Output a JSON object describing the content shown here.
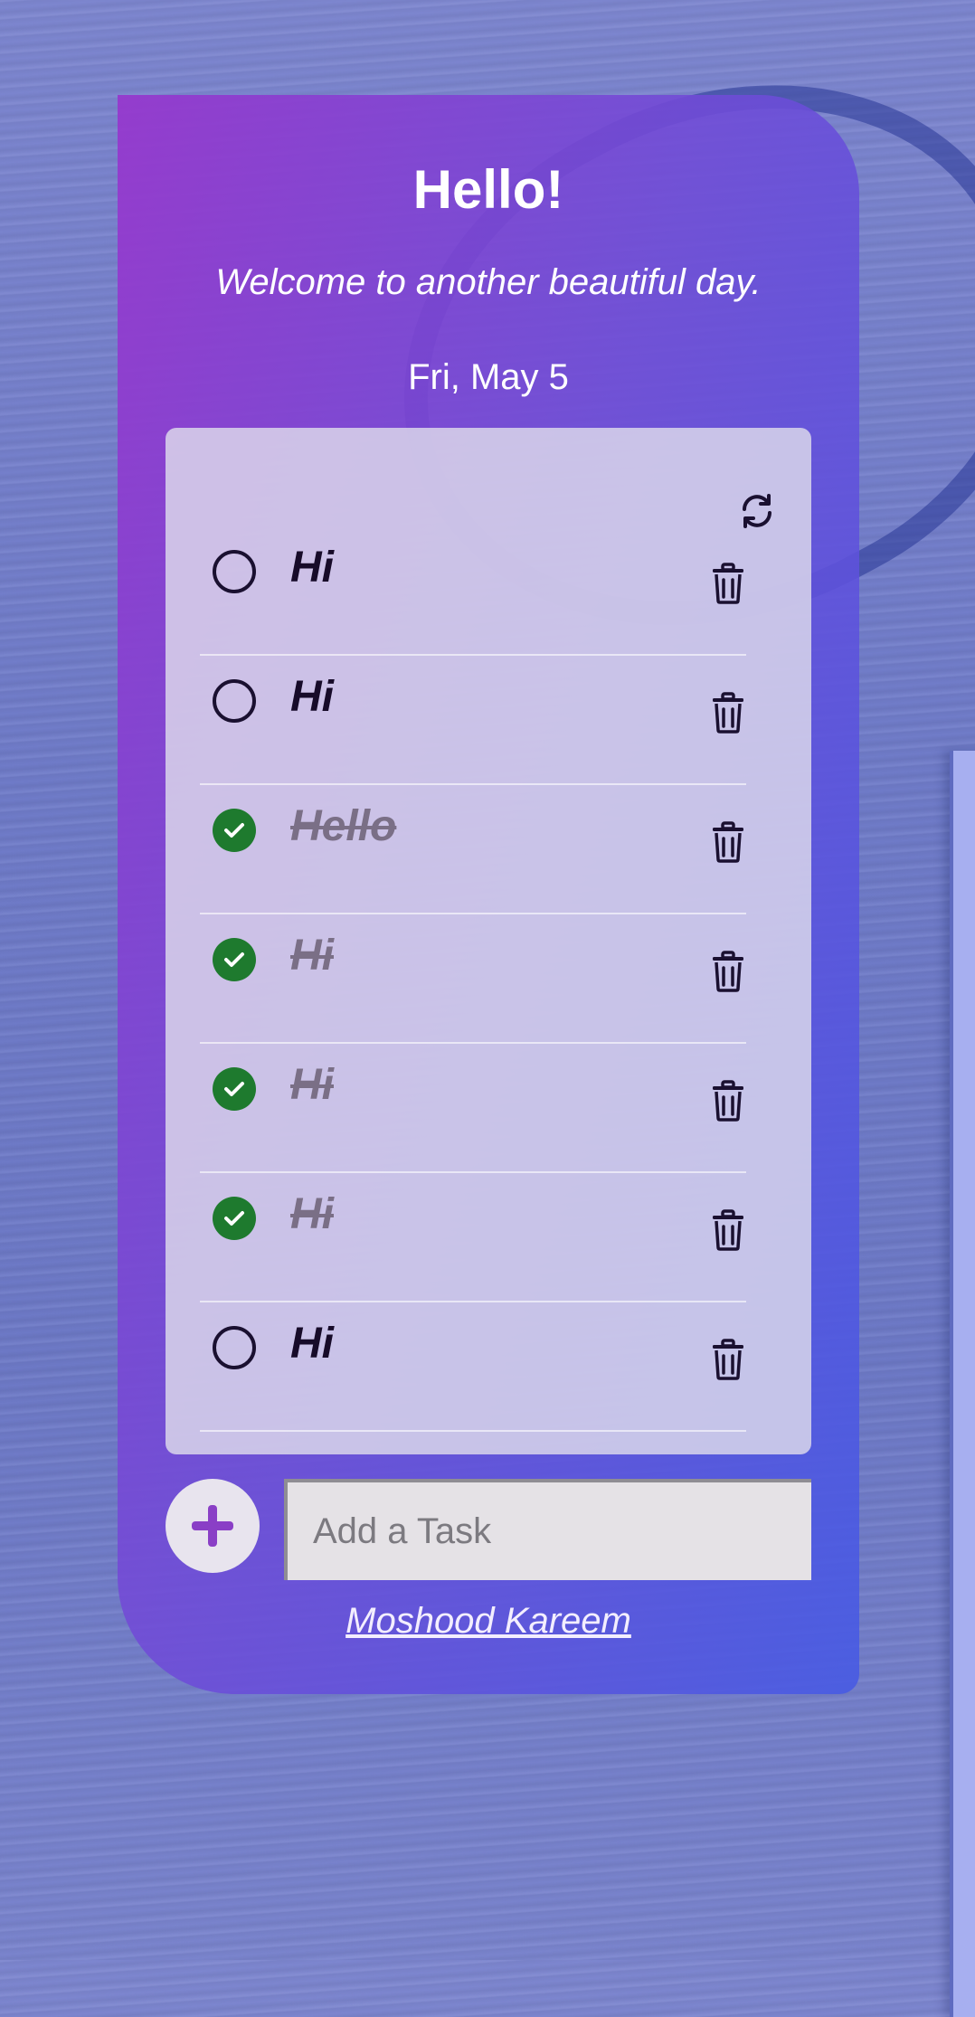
{
  "header": {
    "title": "Hello!",
    "subtitle": "Welcome to another beautiful day.",
    "date": "Fri, May 5"
  },
  "tasks": [
    {
      "text": "Hi",
      "done": false
    },
    {
      "text": "Hi",
      "done": false
    },
    {
      "text": "Hello",
      "done": true
    },
    {
      "text": "Hi",
      "done": true
    },
    {
      "text": "Hi",
      "done": true
    },
    {
      "text": "Hi",
      "done": true
    },
    {
      "text": "Hi",
      "done": false
    }
  ],
  "input": {
    "placeholder": "Add a Task",
    "value": ""
  },
  "footer": {
    "author": "Moshood Kareem"
  },
  "icons": {
    "refresh": "refresh-icon",
    "delete": "trash-icon",
    "unchecked": "circle-outline-icon",
    "checked": "check-circle-icon",
    "add": "plus-icon"
  },
  "colors": {
    "gradient_start": "#9637cd",
    "gradient_end": "#465ae4",
    "check_done": "#1e7a2e",
    "add_icon": "#8a3fc6"
  }
}
